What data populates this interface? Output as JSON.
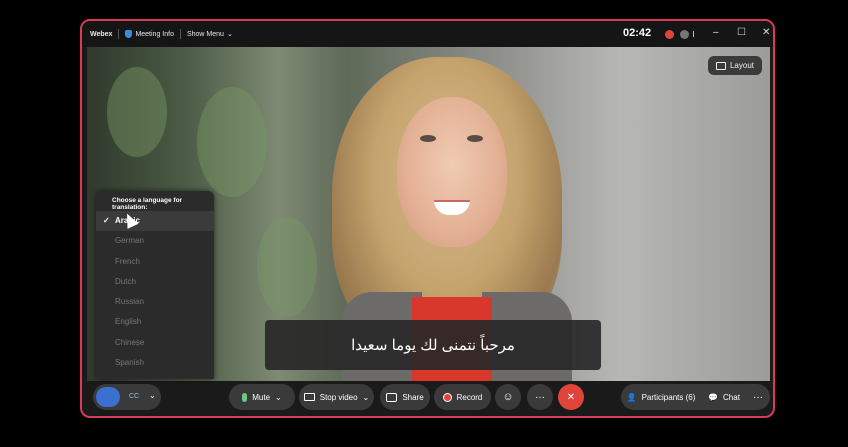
{
  "titlebar": {
    "app_name": "Webex",
    "meeting_info": "Meeting Info",
    "show_menu": "Show Menu",
    "clock": "02:42"
  },
  "video": {
    "layout_label": "Layout"
  },
  "language_menu": {
    "title": "Choose a language for translation:",
    "items": [
      "Arabic",
      "German",
      "French",
      "Dutch",
      "Russian",
      "English",
      "Chinese",
      "Spanish"
    ],
    "selected": "Arabic"
  },
  "caption": {
    "text": "مرحباً نتمنى لك يوما سعيدا"
  },
  "controls": {
    "mute": "Mute",
    "stop_video": "Stop video",
    "share": "Share",
    "record": "Record",
    "more": "···",
    "end": "✕",
    "participants": "Participants (6)",
    "chat": "Chat",
    "right_more": "···"
  },
  "colors": {
    "frame_border": "#d83a57",
    "end_button": "#e0443a",
    "mic_active": "#6ec77d",
    "assistant_button": "#3b6fd0"
  },
  "icons": [
    "shield-icon",
    "chevron-down-icon",
    "record-icon",
    "minimize-icon",
    "maximize-icon",
    "close-icon",
    "layout-icon",
    "check-icon",
    "mic-icon",
    "camera-icon",
    "share-icon",
    "reactions-icon",
    "participants-icon",
    "chat-icon"
  ]
}
